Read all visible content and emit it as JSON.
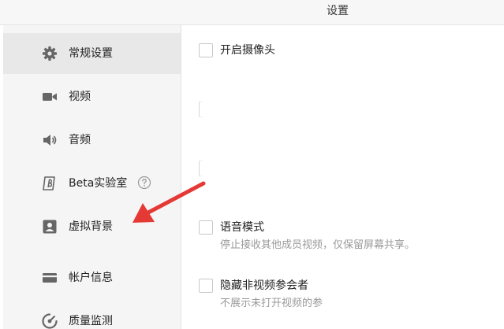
{
  "window": {
    "title": "设置"
  },
  "sidebar": {
    "items": [
      {
        "label": "常规设置",
        "icon": "gear-icon",
        "active": true
      },
      {
        "label": "视频",
        "icon": "video-camera-icon",
        "active": false
      },
      {
        "label": "音频",
        "icon": "speaker-icon",
        "active": false
      },
      {
        "label": "Beta实验室",
        "icon": "beta-icon",
        "active": false,
        "help_icon": "question-circle-icon"
      },
      {
        "label": "虚拟背景",
        "icon": "person-portrait-icon",
        "active": false
      },
      {
        "label": "帐户信息",
        "icon": "card-icon",
        "active": false
      },
      {
        "label": "质量监测",
        "icon": "gauge-icon",
        "active": false
      }
    ]
  },
  "main": {
    "options": [
      {
        "label": "开启摄像头",
        "checked": false
      },
      {
        "label": "语音模式",
        "checked": false,
        "description": "停止接收其他成员视频，仅保留屏幕共享。"
      },
      {
        "label": "隐藏非视频参会者",
        "checked": false,
        "description": "不展示未打开视频的参"
      }
    ]
  },
  "annotation": {
    "arrow_color": "#e53935",
    "points_to": "虚拟背景"
  },
  "colors": {
    "sidebar_bg": "#f5f5f5",
    "active_item_bg": "#e8e8e8",
    "icon_color": "#666666",
    "description_text": "#9a9a9a"
  }
}
